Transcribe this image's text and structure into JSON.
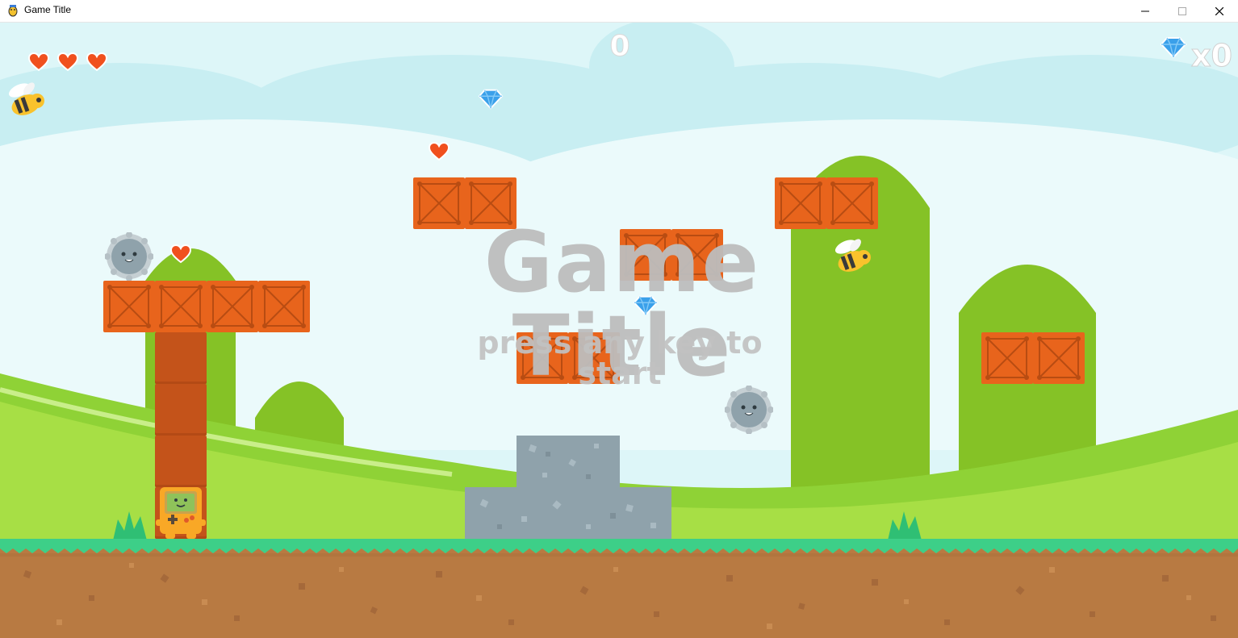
{
  "window": {
    "title": "Game Title",
    "controls": [
      "minimize",
      "maximize",
      "close"
    ]
  },
  "hud": {
    "lives": 3,
    "score": "0",
    "gem_count": "x0"
  },
  "title_screen": {
    "title": "Game Title",
    "prompt": "press any key to start"
  },
  "icons": {
    "app": "pygame-snake-icon",
    "heart": "heart-icon",
    "gem": "blue-gem-icon",
    "bee": "bee-enemy",
    "saw": "spiked-ball-enemy",
    "player": "handheld-console-player"
  },
  "colors": {
    "sky": "#ddf6f8",
    "crate": "#e8641c",
    "trunk": "#c4531a",
    "ground": "#b87a42",
    "grass": "#3dcf88",
    "hill": "#85c226",
    "stone": "#8fa2ab",
    "heart": "#f0501e",
    "gem": "#3aa0ea",
    "title_text": "#bdbdbd"
  }
}
